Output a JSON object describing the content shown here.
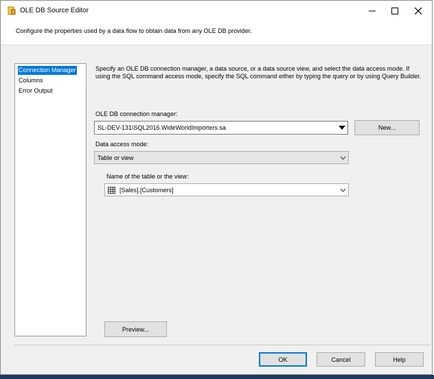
{
  "window": {
    "title": "OLE DB Source Editor",
    "header_text": "Configure the properties used by a data flow to obtain data from any OLE DB provider."
  },
  "sidebar": {
    "items": [
      {
        "label": "Connection Manager",
        "selected": true
      },
      {
        "label": "Columns",
        "selected": false
      },
      {
        "label": "Error Output",
        "selected": false
      }
    ]
  },
  "main": {
    "description": "Specify an OLE DB connection manager, a data source, or a data source view, and select the data access mode. If using the SQL command access mode, specify the SQL command either by typing the query or by using Query Builder.",
    "connection_manager_label": "OLE DB connection manager:",
    "connection_manager_value": "SL-DEV-131\\SQL2016.WideWorldImporters.sa",
    "new_button": "New...",
    "access_mode_label": "Data access mode:",
    "access_mode_value": "Table or view",
    "table_label": "Name of the table or the view:",
    "table_value": "[Sales].[Customers]",
    "preview_button": "Preview..."
  },
  "footer": {
    "ok": "OK",
    "cancel": "Cancel",
    "help": "Help"
  },
  "colors": {
    "selection": "#0078d7",
    "dialog_bg": "#f0f0f0",
    "taskbar": "#1e3a5c"
  },
  "icons": [
    "app-icon",
    "minimize-icon",
    "maximize-icon",
    "close-icon",
    "chevron-down-icon",
    "table-icon"
  ]
}
